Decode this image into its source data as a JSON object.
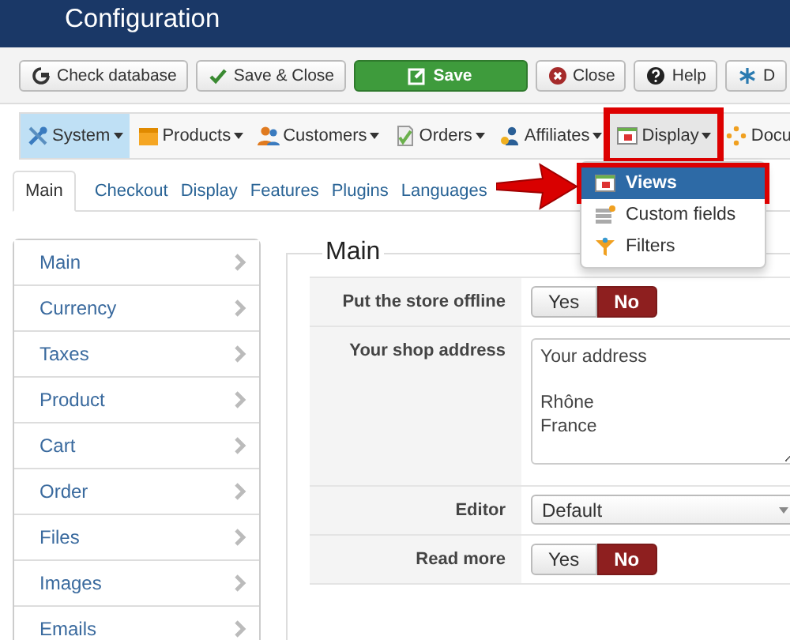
{
  "header": {
    "title": "Configuration"
  },
  "toolbar": [
    {
      "label": "Check database",
      "kind": "plain"
    },
    {
      "label": "Save & Close",
      "kind": "plain"
    },
    {
      "label": "Save",
      "kind": "primary"
    },
    {
      "label": "Close",
      "kind": "plain"
    },
    {
      "label": "Help",
      "kind": "plain"
    },
    {
      "label": "D",
      "kind": "plain"
    }
  ],
  "menu": [
    {
      "label": "System",
      "selected": true,
      "open": false,
      "caret": true,
      "highlighted": false
    },
    {
      "label": "Products",
      "selected": false,
      "open": false,
      "caret": true,
      "highlighted": false
    },
    {
      "label": "Customers",
      "selected": false,
      "open": false,
      "caret": true,
      "highlighted": false
    },
    {
      "label": "Orders",
      "selected": false,
      "open": false,
      "caret": true,
      "highlighted": false
    },
    {
      "label": "Affiliates",
      "selected": false,
      "open": false,
      "caret": true,
      "highlighted": false
    },
    {
      "label": "Display",
      "selected": false,
      "open": true,
      "caret": true,
      "highlighted": true
    },
    {
      "label": "Docu",
      "selected": false,
      "open": false,
      "caret": false,
      "highlighted": false
    }
  ],
  "dropdown": [
    {
      "label": "Views",
      "selected": true,
      "highlighted": true
    },
    {
      "label": "Custom fields",
      "selected": false,
      "highlighted": false
    },
    {
      "label": "Filters",
      "selected": false,
      "highlighted": false
    }
  ],
  "tabs": [
    {
      "label": "Main",
      "selected": true
    },
    {
      "label": "Checkout",
      "selected": false
    },
    {
      "label": "Display",
      "selected": false
    },
    {
      "label": "Features",
      "selected": false
    },
    {
      "label": "Plugins",
      "selected": false
    },
    {
      "label": "Languages",
      "selected": false
    }
  ],
  "sidebar": {
    "items": [
      "Main",
      "Currency",
      "Taxes",
      "Product",
      "Cart",
      "Order",
      "Files",
      "Images",
      "Emails"
    ]
  },
  "form": {
    "legend": "Main",
    "rows": [
      {
        "label": "Put the store offline",
        "kind": "toggle",
        "options": [
          {
            "label": "Yes",
            "selected": false
          },
          {
            "label": "No",
            "selected": true
          }
        ]
      },
      {
        "label": "Your shop address",
        "kind": "textarea",
        "value": "Your address\n\nRhône\nFrance"
      },
      {
        "label": "Editor",
        "kind": "select",
        "value": "Default"
      },
      {
        "label": "Read more",
        "kind": "toggle",
        "options": [
          {
            "label": "Yes",
            "selected": false
          },
          {
            "label": "No",
            "selected": true
          }
        ]
      }
    ]
  }
}
